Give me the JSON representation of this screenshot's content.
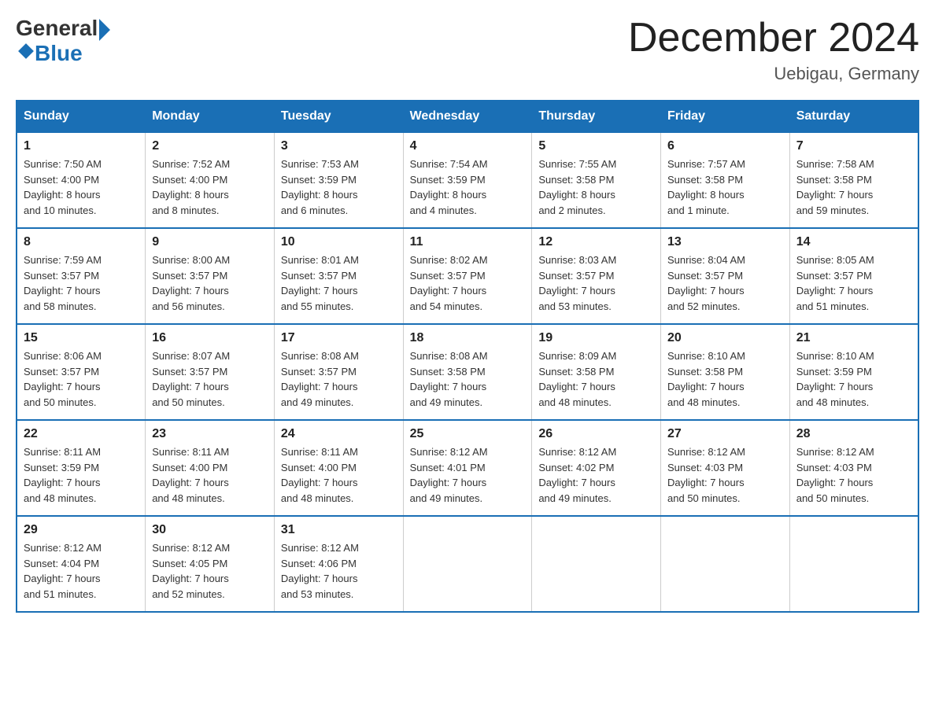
{
  "logo": {
    "general": "General",
    "blue": "Blue"
  },
  "header": {
    "month_year": "December 2024",
    "location": "Uebigau, Germany"
  },
  "weekdays": [
    "Sunday",
    "Monday",
    "Tuesday",
    "Wednesday",
    "Thursday",
    "Friday",
    "Saturday"
  ],
  "weeks": [
    [
      {
        "day": "1",
        "info": "Sunrise: 7:50 AM\nSunset: 4:00 PM\nDaylight: 8 hours\nand 10 minutes."
      },
      {
        "day": "2",
        "info": "Sunrise: 7:52 AM\nSunset: 4:00 PM\nDaylight: 8 hours\nand 8 minutes."
      },
      {
        "day": "3",
        "info": "Sunrise: 7:53 AM\nSunset: 3:59 PM\nDaylight: 8 hours\nand 6 minutes."
      },
      {
        "day": "4",
        "info": "Sunrise: 7:54 AM\nSunset: 3:59 PM\nDaylight: 8 hours\nand 4 minutes."
      },
      {
        "day": "5",
        "info": "Sunrise: 7:55 AM\nSunset: 3:58 PM\nDaylight: 8 hours\nand 2 minutes."
      },
      {
        "day": "6",
        "info": "Sunrise: 7:57 AM\nSunset: 3:58 PM\nDaylight: 8 hours\nand 1 minute."
      },
      {
        "day": "7",
        "info": "Sunrise: 7:58 AM\nSunset: 3:58 PM\nDaylight: 7 hours\nand 59 minutes."
      }
    ],
    [
      {
        "day": "8",
        "info": "Sunrise: 7:59 AM\nSunset: 3:57 PM\nDaylight: 7 hours\nand 58 minutes."
      },
      {
        "day": "9",
        "info": "Sunrise: 8:00 AM\nSunset: 3:57 PM\nDaylight: 7 hours\nand 56 minutes."
      },
      {
        "day": "10",
        "info": "Sunrise: 8:01 AM\nSunset: 3:57 PM\nDaylight: 7 hours\nand 55 minutes."
      },
      {
        "day": "11",
        "info": "Sunrise: 8:02 AM\nSunset: 3:57 PM\nDaylight: 7 hours\nand 54 minutes."
      },
      {
        "day": "12",
        "info": "Sunrise: 8:03 AM\nSunset: 3:57 PM\nDaylight: 7 hours\nand 53 minutes."
      },
      {
        "day": "13",
        "info": "Sunrise: 8:04 AM\nSunset: 3:57 PM\nDaylight: 7 hours\nand 52 minutes."
      },
      {
        "day": "14",
        "info": "Sunrise: 8:05 AM\nSunset: 3:57 PM\nDaylight: 7 hours\nand 51 minutes."
      }
    ],
    [
      {
        "day": "15",
        "info": "Sunrise: 8:06 AM\nSunset: 3:57 PM\nDaylight: 7 hours\nand 50 minutes."
      },
      {
        "day": "16",
        "info": "Sunrise: 8:07 AM\nSunset: 3:57 PM\nDaylight: 7 hours\nand 50 minutes."
      },
      {
        "day": "17",
        "info": "Sunrise: 8:08 AM\nSunset: 3:57 PM\nDaylight: 7 hours\nand 49 minutes."
      },
      {
        "day": "18",
        "info": "Sunrise: 8:08 AM\nSunset: 3:58 PM\nDaylight: 7 hours\nand 49 minutes."
      },
      {
        "day": "19",
        "info": "Sunrise: 8:09 AM\nSunset: 3:58 PM\nDaylight: 7 hours\nand 48 minutes."
      },
      {
        "day": "20",
        "info": "Sunrise: 8:10 AM\nSunset: 3:58 PM\nDaylight: 7 hours\nand 48 minutes."
      },
      {
        "day": "21",
        "info": "Sunrise: 8:10 AM\nSunset: 3:59 PM\nDaylight: 7 hours\nand 48 minutes."
      }
    ],
    [
      {
        "day": "22",
        "info": "Sunrise: 8:11 AM\nSunset: 3:59 PM\nDaylight: 7 hours\nand 48 minutes."
      },
      {
        "day": "23",
        "info": "Sunrise: 8:11 AM\nSunset: 4:00 PM\nDaylight: 7 hours\nand 48 minutes."
      },
      {
        "day": "24",
        "info": "Sunrise: 8:11 AM\nSunset: 4:00 PM\nDaylight: 7 hours\nand 48 minutes."
      },
      {
        "day": "25",
        "info": "Sunrise: 8:12 AM\nSunset: 4:01 PM\nDaylight: 7 hours\nand 49 minutes."
      },
      {
        "day": "26",
        "info": "Sunrise: 8:12 AM\nSunset: 4:02 PM\nDaylight: 7 hours\nand 49 minutes."
      },
      {
        "day": "27",
        "info": "Sunrise: 8:12 AM\nSunset: 4:03 PM\nDaylight: 7 hours\nand 50 minutes."
      },
      {
        "day": "28",
        "info": "Sunrise: 8:12 AM\nSunset: 4:03 PM\nDaylight: 7 hours\nand 50 minutes."
      }
    ],
    [
      {
        "day": "29",
        "info": "Sunrise: 8:12 AM\nSunset: 4:04 PM\nDaylight: 7 hours\nand 51 minutes."
      },
      {
        "day": "30",
        "info": "Sunrise: 8:12 AM\nSunset: 4:05 PM\nDaylight: 7 hours\nand 52 minutes."
      },
      {
        "day": "31",
        "info": "Sunrise: 8:12 AM\nSunset: 4:06 PM\nDaylight: 7 hours\nand 53 minutes."
      },
      {
        "day": "",
        "info": ""
      },
      {
        "day": "",
        "info": ""
      },
      {
        "day": "",
        "info": ""
      },
      {
        "day": "",
        "info": ""
      }
    ]
  ]
}
